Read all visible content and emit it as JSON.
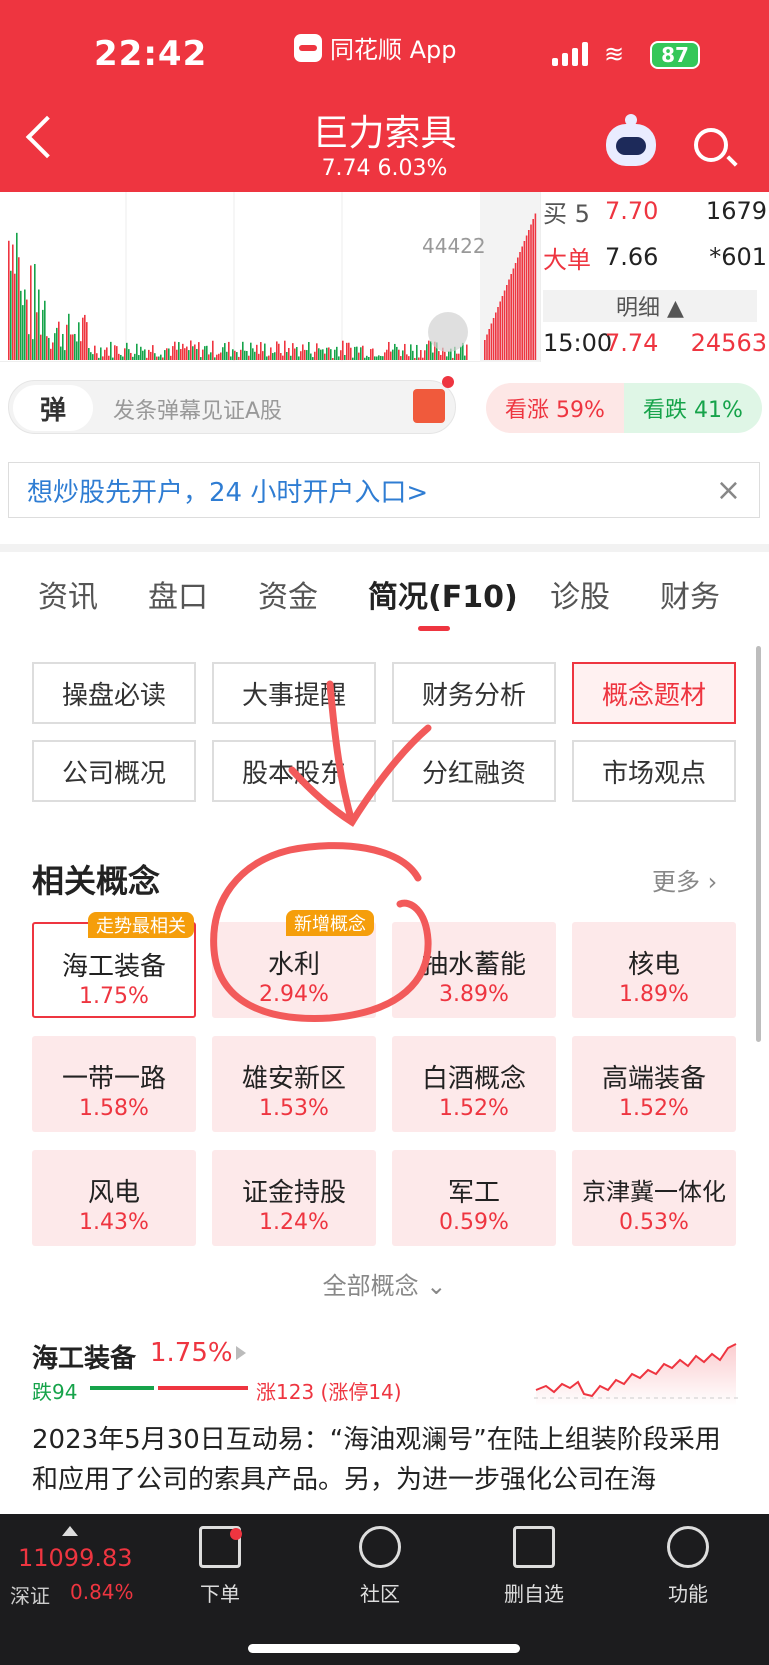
{
  "status": {
    "time": "22:42",
    "app": "同花顺 App",
    "battery": "87"
  },
  "header": {
    "title": "巨力索具",
    "price_line": "7.74 6.03%"
  },
  "chart": {
    "volume_label": "44422"
  },
  "order_book": [
    {
      "label": "买 5",
      "price": "7.70",
      "volume": "1679"
    },
    {
      "label": "大单",
      "price": "7.66",
      "volume": "*601"
    },
    {
      "label": "15:00",
      "price": "7.74",
      "volume": "24563"
    }
  ],
  "detail_label": "明细 ▲",
  "barrage": {
    "tag": "弹",
    "placeholder": "发条弹幕见证A股"
  },
  "sentiment": {
    "bull": "看涨 59%",
    "bear": "看跌 41%"
  },
  "banner": {
    "text": "想炒股先开户，24 小时开户入口>",
    "close": "×"
  },
  "tabs": [
    "资讯",
    "盘口",
    "资金",
    "简况(F10)",
    "诊股",
    "财务"
  ],
  "grid_buttons": [
    "操盘必读",
    "大事提醒",
    "财务分析",
    "概念题材",
    "公司概况",
    "股本股东",
    "分红融资",
    "市场观点"
  ],
  "concepts_section": {
    "title": "相关概念",
    "more": "更多 ›",
    "all": "全部概念 ⌄"
  },
  "concepts": [
    {
      "name": "海工装备",
      "pct": "1.75%",
      "badge": "走势最相关"
    },
    {
      "name": "水利",
      "pct": "2.94%",
      "badge": "新增概念"
    },
    {
      "name": "抽水蓄能",
      "pct": "3.89%"
    },
    {
      "name": "核电",
      "pct": "1.89%"
    },
    {
      "name": "一带一路",
      "pct": "1.58%"
    },
    {
      "name": "雄安新区",
      "pct": "1.53%"
    },
    {
      "name": "白酒概念",
      "pct": "1.52%"
    },
    {
      "name": "高端装备",
      "pct": "1.52%"
    },
    {
      "name": "风电",
      "pct": "1.43%"
    },
    {
      "name": "证金持股",
      "pct": "1.24%"
    },
    {
      "name": "军工",
      "pct": "0.59%"
    },
    {
      "name": "京津冀一体化",
      "pct": "0.53%"
    }
  ],
  "detail": {
    "title": "海工装备",
    "pct": "1.75%",
    "fall": "跌94",
    "rise": "涨123 (涨停14)",
    "body": "2023年5月30日互动易：“海油观澜号”在陆上组装阶段采用和应用了公司的索具产品。另，为进一步强化公司在海"
  },
  "bottom": {
    "index_value": "11099.83",
    "index_name": "深证",
    "index_pct": "0.84%",
    "nav": [
      "下单",
      "社区",
      "删自选",
      "功能"
    ]
  },
  "colors": {
    "brand_red": "#ee3540",
    "up_green": "#16a34a"
  }
}
